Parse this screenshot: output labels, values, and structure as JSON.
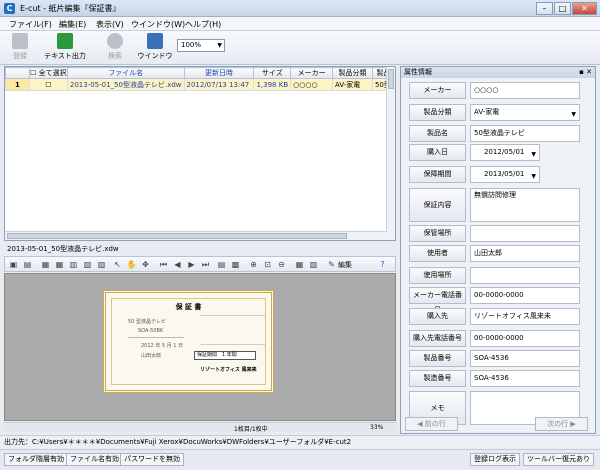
{
  "window": {
    "title": "E-cut - 紙片編集『保証書』",
    "app_icon": "C"
  },
  "menu": [
    "ファイル(F)",
    "編集(E)",
    "表示(V)",
    "ウインドウ(W)",
    "ヘルプ(H)"
  ],
  "toolbar": {
    "buttons": [
      {
        "label": "登録",
        "icon": "register-icon",
        "disabled": true
      },
      {
        "label": "テキスト出力",
        "icon": "text-export-icon",
        "disabled": false
      },
      {
        "label": "検索",
        "icon": "search-icon",
        "disabled": true
      },
      {
        "label": "ウインドウ",
        "icon": "window-icon",
        "disabled": false
      }
    ],
    "zoom": "100%"
  },
  "grid": {
    "headers": [
      "",
      "全て選択",
      "ファイル名",
      "更新日時",
      "サイズ",
      "メーカー",
      "製品分類",
      "製品"
    ],
    "rows": [
      {
        "num": "1",
        "checked": false,
        "filename": "2013-05-01_50型液晶テレビ.xdw",
        "updated": "2012/07/13 13:47",
        "size": "1,398 KB",
        "maker": "○○○○",
        "category": "AV-家電",
        "product": "50型"
      }
    ]
  },
  "preview": {
    "title": "2013-05-01_50型液晶テレビ.xdw",
    "edit_label": "編集",
    "page_status": "1枚目/1枚中",
    "zoom_status": "33%",
    "cert": {
      "heading": "保 証 書",
      "product": "50 型液晶テレビ",
      "model": "SOA-50BK",
      "date": "2012 年 5 月 1 日",
      "buyer": "山田太郎",
      "period_label": "保証期間",
      "period_value": "1 年間",
      "shop": "リゾートオフィス 風来来"
    }
  },
  "output_path": "出力先：C:¥Users¥＊＊＊＊¥Documents¥Fuji Xerox¥DocuWorks¥DWFolders¥ユーザーフォルダ¥E-cut2",
  "statusbar": {
    "left": [
      "フォルダ階層有効",
      "ファイル名有効",
      "パスワードを無効"
    ],
    "right": [
      "登録ログ表示",
      "ツールバー復元あり"
    ]
  },
  "panel": {
    "title": "属性情報",
    "fields": [
      {
        "label": "メーカー",
        "value": "○○○○"
      },
      {
        "label": "製品分類",
        "value": "AV-家電",
        "dropdown": true
      },
      {
        "label": "製品名",
        "value": "50型液晶テレビ"
      },
      {
        "label": "購入日",
        "value": "2012/05/01",
        "dropdown": true
      },
      {
        "label": "保障期間",
        "value": "2013/05/01",
        "dropdown": true
      },
      {
        "label": "保証内容",
        "value": "無償訪問修理"
      },
      {
        "label": "保管場所",
        "value": ""
      },
      {
        "label": "使用者",
        "value": "山田太郎"
      },
      {
        "label": "使用場所",
        "value": ""
      },
      {
        "label": "メーカー電話番号",
        "value": "00-0000-0000"
      },
      {
        "label": "購入先",
        "value": "リゾートオフィス風来未"
      },
      {
        "label": "購入先電話番号",
        "value": "00-0000-0000"
      },
      {
        "label": "製品番号",
        "value": "SOA-4536"
      },
      {
        "label": "製造番号",
        "value": "SOA-4536"
      },
      {
        "label": "メモ",
        "value": ""
      }
    ],
    "prev_label": "前の行",
    "next_label": "次の行"
  },
  "colors": {
    "accent": "#1f6fc5",
    "link": "#1c3fb0",
    "row_highlight": "#fbe9a0"
  }
}
